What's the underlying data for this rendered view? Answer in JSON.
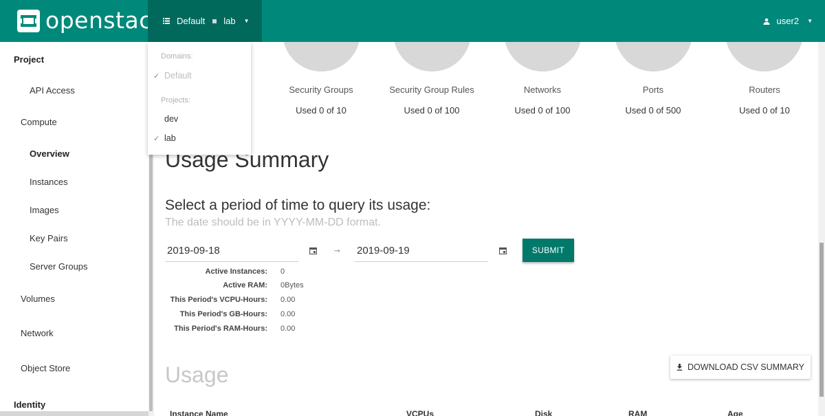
{
  "app": {
    "brand": "openstack",
    "trademark": "®"
  },
  "context": {
    "domain": "Default",
    "project": "lab"
  },
  "user": {
    "name": "user2"
  },
  "dropdown": {
    "domains_header": "Domains:",
    "domains": [
      {
        "label": "Default",
        "checked": true,
        "disabled": true
      }
    ],
    "projects_header": "Projects:",
    "projects": [
      {
        "label": "dev",
        "checked": false
      },
      {
        "label": "lab",
        "checked": true
      }
    ]
  },
  "sidebar": {
    "items": [
      {
        "label": "Project",
        "type": "header"
      },
      {
        "label": "API Access",
        "type": "sub"
      },
      {
        "label": "Compute",
        "type": "group"
      },
      {
        "label": "Overview",
        "type": "sub",
        "active": true
      },
      {
        "label": "Instances",
        "type": "sub"
      },
      {
        "label": "Images",
        "type": "sub"
      },
      {
        "label": "Key Pairs",
        "type": "sub"
      },
      {
        "label": "Server Groups",
        "type": "sub"
      },
      {
        "label": "Volumes",
        "type": "group"
      },
      {
        "label": "Network",
        "type": "group"
      },
      {
        "label": "Object Store",
        "type": "group"
      },
      {
        "label": "Identity",
        "type": "header"
      }
    ]
  },
  "quotas": [
    {
      "label": "Security Groups",
      "used": "Used 0 of 10"
    },
    {
      "label": "Security Group Rules",
      "used": "Used 0 of 100"
    },
    {
      "label": "Networks",
      "used": "Used 0 of 100"
    },
    {
      "label": "Ports",
      "used": "Used 0 of 500"
    },
    {
      "label": "Routers",
      "used": "Used 0 of 10"
    }
  ],
  "summary": {
    "title": "Usage Summary",
    "period_title": "Select a period of time to query its usage:",
    "period_hint": "The date should be in YYYY-MM-DD format.",
    "start_date": "2019-09-18",
    "end_date": "2019-09-19",
    "submit_label": "SUBMIT",
    "stats": [
      {
        "label": "Active Instances:",
        "value": "0"
      },
      {
        "label": "Active RAM:",
        "value": "0Bytes"
      },
      {
        "label": "This Period's VCPU-Hours:",
        "value": "0.00"
      },
      {
        "label": "This Period's GB-Hours:",
        "value": "0.00"
      },
      {
        "label": "This Period's RAM-Hours:",
        "value": "0.00"
      }
    ]
  },
  "usage": {
    "title": "Usage",
    "download_label": "DOWNLOAD CSV SUMMARY",
    "columns": [
      "Instance Name",
      "VCPUs",
      "Disk",
      "RAM",
      "Age"
    ]
  },
  "colors": {
    "brand": "#00897b",
    "brand_dark": "#00695c",
    "button": "#00796b"
  }
}
